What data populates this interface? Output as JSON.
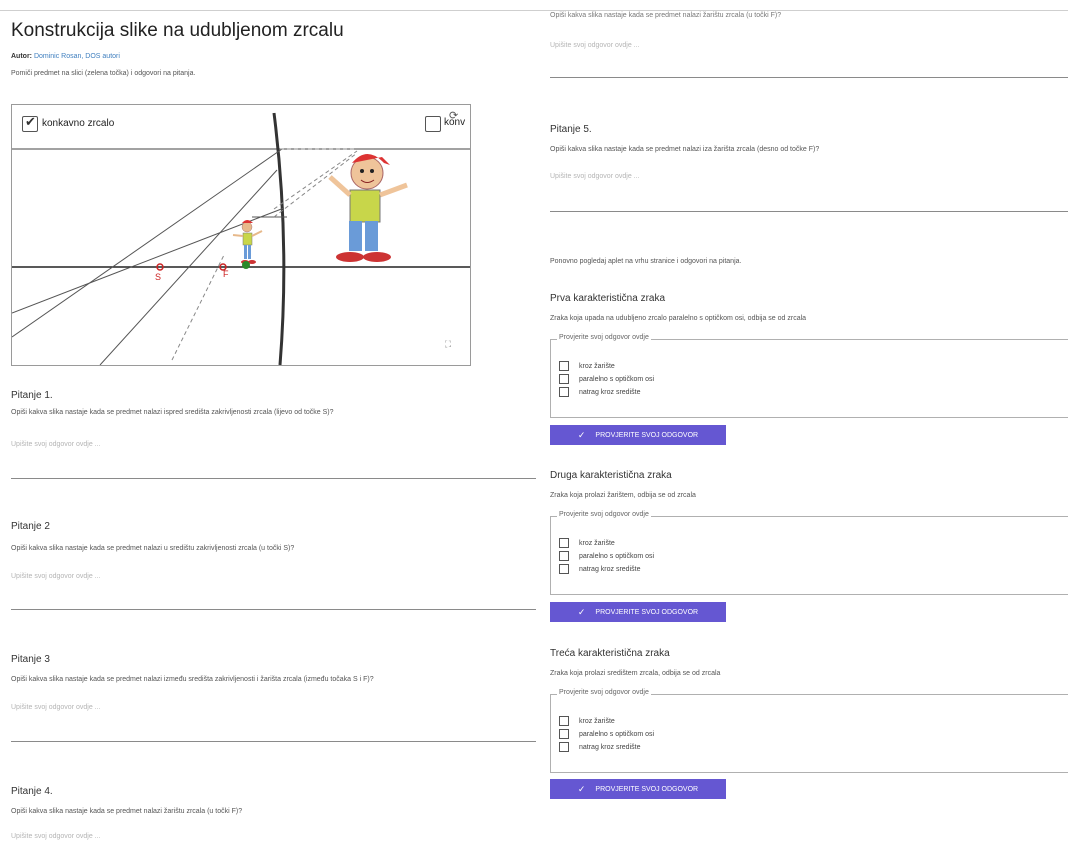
{
  "page": {
    "title": "Konstrukcija slike na udubljenom zrcalu",
    "author_label": "Autor:",
    "author_names": "Dominic Rosan, DOS autori",
    "instruction": "Pomiči predmet na slici (zelena točka) i odgovori na pitanja."
  },
  "applet": {
    "checkbox1_label": "konkavno zrcalo",
    "checkbox2_label": "konv",
    "label_S": "S",
    "label_F": "F",
    "reset_icon": "refresh-icon",
    "fullscreen_icon": "fullscreen-icon",
    "colors": {
      "axis": "#222222",
      "point": "#cc2222",
      "object": "#2a8a2a"
    }
  },
  "questions": [
    {
      "title": "Pitanje 1.",
      "text": "Opiši kakva slika nastaje kada se predmet nalazi ispred središta zakrivljenosti zrcala (lijevo od točke S)?",
      "placeholder": "Upišite svoj odgovor ovdje ..."
    },
    {
      "title": "Pitanje 2",
      "text": "Opiši kakva slika nastaje kada se predmet nalazi u središtu zakrivljenosti zrcala (u točki S)?",
      "placeholder": "Upišite svoj odgovor ovdje ..."
    },
    {
      "title": "Pitanje 3",
      "text": "Opiši kakva slika nastaje kada se predmet nalazi između središta zakrivljenosti i žarišta zrcala (između točaka S i F)?",
      "placeholder": "Upišite svoj odgovor ovdje ..."
    },
    {
      "title": "Pitanje 4.",
      "text": "Opiši kakva slika nastaje kada se predmet nalazi žarištu zrcala (u točki F)?",
      "placeholder": "Upišite svoj odgovor ovdje ..."
    },
    {
      "title": "Pitanje 5.",
      "text": "Opiši kakva slika nastaje kada se predmet nalazi iza žarišta zrcala (desno od točke F)?",
      "placeholder": "Upišite svoj odgovor ovdje ..."
    }
  ],
  "right_top": {
    "text": "Opiši kakva slika nastaje kada se predmet nalazi žarištu zrcala (u točki F)?",
    "placeholder": "Upišite svoj odgovor ovdje ..."
  },
  "revisit_text": "Ponovno pogledaj aplet na vrhu stranice i odgovori na pitanja.",
  "rays": [
    {
      "title": "Prva karakteristična zraka",
      "desc": "Zraka koja upada na udubljeno zrcalo paralelno s optičkom osi, odbija se od zrcala"
    },
    {
      "title": "Druga karakteristična zraka",
      "desc": "Zraka koja prolazi žarištem, odbija se od zrcala"
    },
    {
      "title": "Treća karakteristična zraka",
      "desc": "Zraka koja prolazi središtem zrcala, odbija se od zrcala"
    }
  ],
  "check": {
    "legend": "Provjerite svoj odgovor ovdje",
    "options": [
      "kroz žarište",
      "paralelno s optičkom osi",
      "natrag kroz središte"
    ],
    "button": "PROVJERITE SVOJ ODGOVOR"
  }
}
